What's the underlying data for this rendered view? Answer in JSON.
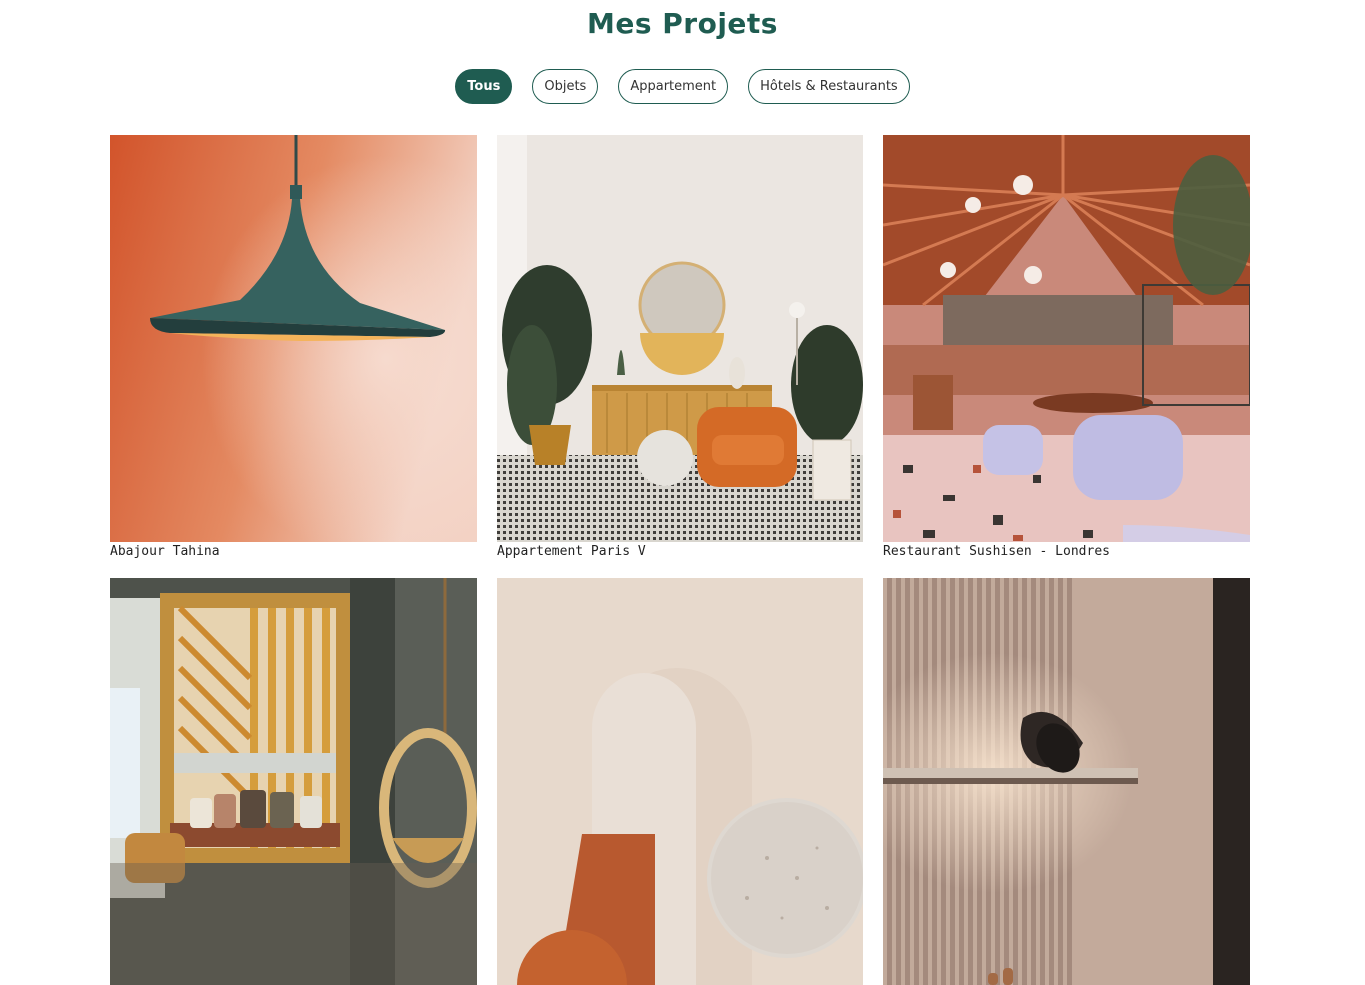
{
  "header": {
    "title": "Mes Projets"
  },
  "filters": [
    {
      "label": "Tous",
      "active": true
    },
    {
      "label": "Objets",
      "active": false
    },
    {
      "label": "Appartement",
      "active": false
    },
    {
      "label": "Hôtels & Restaurants",
      "active": false
    }
  ],
  "projects": [
    {
      "caption": "Abajour Tahina",
      "image": "pendant-lamp-orange-wall"
    },
    {
      "caption": "Appartement Paris V",
      "image": "living-room-orange-armchair"
    },
    {
      "caption": "Restaurant Sushisen - Londres",
      "image": "restaurant-lilac-chairs-greenhouse"
    },
    {
      "caption": "",
      "image": "window-bench-hanging-chair"
    },
    {
      "caption": "",
      "image": "beige-arch-terrazzo-objects"
    },
    {
      "caption": "",
      "image": "wall-sconce-shelf-lighting"
    }
  ]
}
